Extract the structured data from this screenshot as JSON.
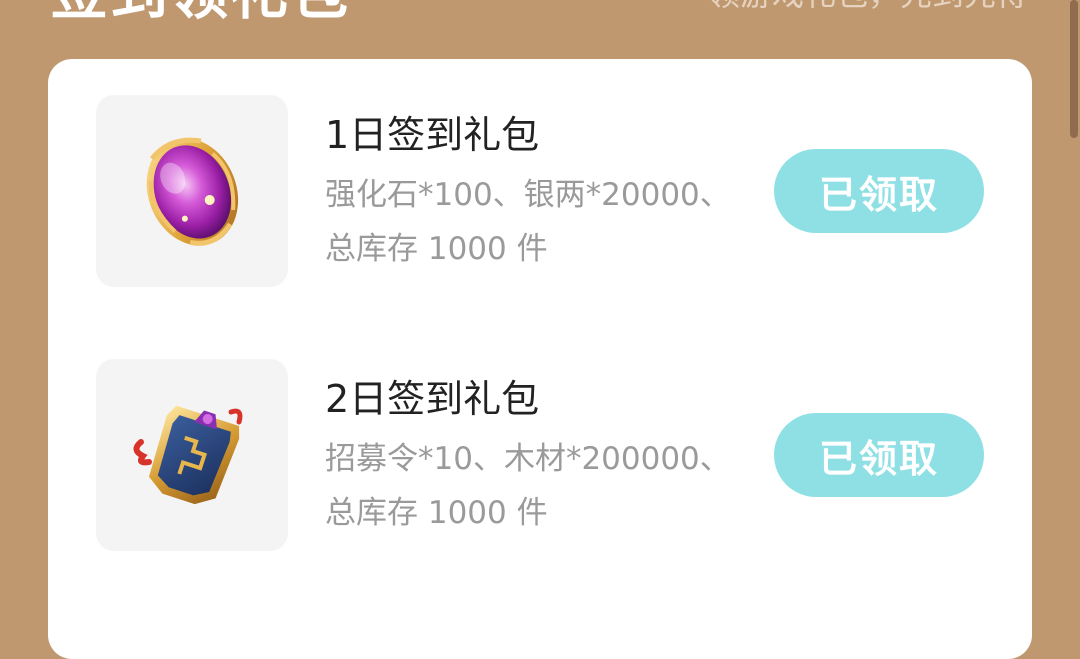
{
  "header": {
    "title": "签到领礼包",
    "subtitle": "领游戏礼包，先到先得"
  },
  "gifts": [
    {
      "name": "1日签到礼包",
      "contents": "强化石*100、银两*20000、",
      "stock": "总库存 1000 件",
      "button_label": "已领取",
      "icon": "purple-gem-icon"
    },
    {
      "name": "2日签到礼包",
      "contents": "招募令*10、木材*200000、",
      "stock": "总库存 1000 件",
      "button_label": "已领取",
      "icon": "recruit-token-icon"
    }
  ],
  "colors": {
    "background": "#bf9870",
    "card": "#ffffff",
    "button": "#8ee0e4",
    "thumb_background": "#f4f4f4",
    "muted_text": "#9a9a9a"
  }
}
